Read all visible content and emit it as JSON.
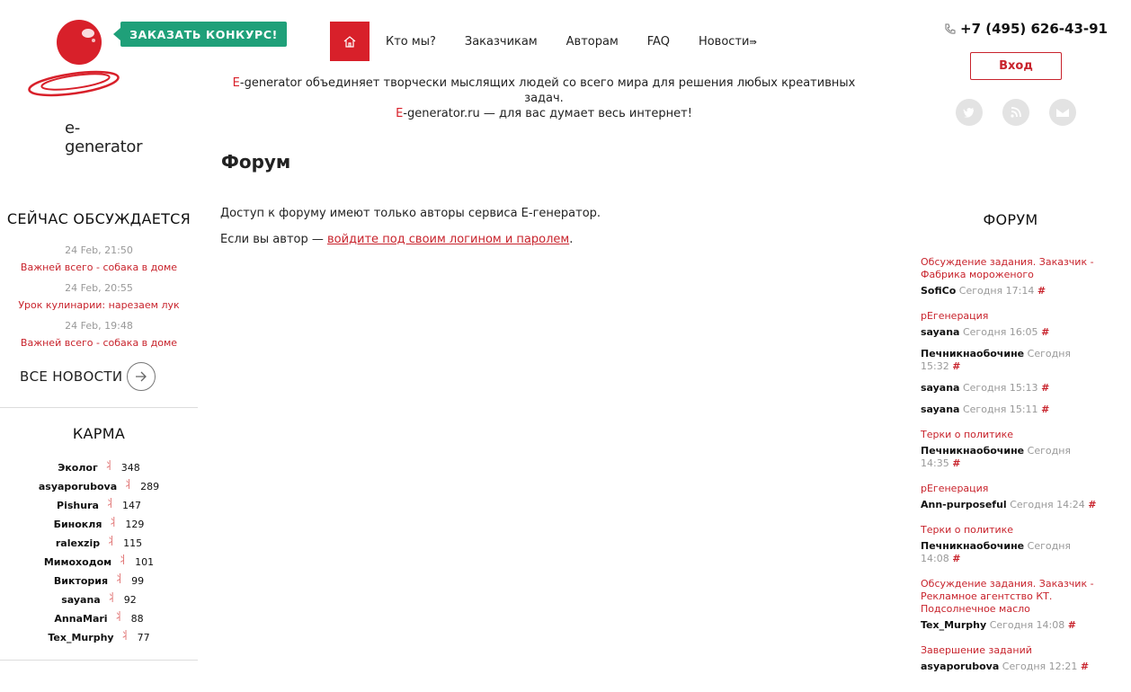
{
  "brand": {
    "name": "e-generator",
    "red": "#d8202a",
    "green": "#1fa079"
  },
  "header": {
    "order_label": "ЗАКАЗАТЬ КОНКУРС!",
    "nav": [
      "Кто мы?",
      "Заказчикам",
      "Авторам",
      "FAQ",
      "Новости"
    ],
    "tagline_1a": "E",
    "tagline_1b": "-generator объединяет творчески мыслящих людей со всего мира для решения любых креативных задач.",
    "tagline_2a": "E",
    "tagline_2b": "-generator.ru — для вас думает весь интернет!",
    "phone": "+7 (495) 626-43-91",
    "login": "Вход",
    "social_icons": [
      "twitter-icon",
      "rss-icon",
      "mail-icon"
    ]
  },
  "main": {
    "title": "Форум",
    "access_text": "Доступ к форуму имеют только авторы сервиса Е-генератор.",
    "author_prefix": "Если вы автор — ",
    "author_link": "войдите под своим логином и паролем",
    "author_suffix": "."
  },
  "left": {
    "discuss_title": "СЕЙЧАС ОБСУЖДАЕТСЯ",
    "discuss": [
      {
        "date": "24 Feb, 21:50",
        "title": "Важней всего - собака в доме"
      },
      {
        "date": "24 Feb, 20:55",
        "title": "Урок кулинарии: нарезаем лук"
      },
      {
        "date": "24 Feb, 19:48",
        "title": "Важней всего - собака в доме"
      }
    ],
    "all_news": "ВСЕ НОВОСТИ",
    "karma_title": "КАРМА",
    "karma": [
      {
        "name": "Эколог",
        "value": "348"
      },
      {
        "name": "asyaporubova",
        "value": "289"
      },
      {
        "name": "Pishura",
        "value": "147"
      },
      {
        "name": "Бинокля",
        "value": "129"
      },
      {
        "name": "ralexzip",
        "value": "115"
      },
      {
        "name": "Мимоходом",
        "value": "101"
      },
      {
        "name": "Виктория",
        "value": "99"
      },
      {
        "name": "sayana",
        "value": "92"
      },
      {
        "name": "AnnaMari",
        "value": "88"
      },
      {
        "name": "Tex_Murphy",
        "value": "77"
      }
    ]
  },
  "right": {
    "forum_title": "ФОРУМ",
    "topics": [
      {
        "title": "Обсуждение задания. Заказчик - Фабрика мороженого",
        "posts": [
          {
            "user": "SofiCo",
            "time": "Сегодня 17:14"
          }
        ]
      },
      {
        "title": "рЕгенерация",
        "posts": [
          {
            "user": "sayana",
            "time": "Сегодня 16:05"
          },
          {
            "user": "Печникнаобочине",
            "time": "Сегодня 15:32"
          },
          {
            "user": "sayana",
            "time": "Сегодня 15:13"
          },
          {
            "user": "sayana",
            "time": "Сегодня 15:11"
          }
        ]
      },
      {
        "title": "Терки о политике",
        "posts": [
          {
            "user": "Печникнаобочине",
            "time": "Сегодня 14:35"
          }
        ]
      },
      {
        "title": "рЕгенерация",
        "posts": [
          {
            "user": "Ann-purposeful",
            "time": "Сегодня 14:24"
          }
        ]
      },
      {
        "title": "Терки о политике",
        "posts": [
          {
            "user": "Печникнаобочине",
            "time": "Сегодня 14:08"
          }
        ]
      },
      {
        "title": "Обсуждение задания. Заказчик - Рекламное агентство КТ. Подсолнечное масло",
        "posts": [
          {
            "user": "Tex_Murphy",
            "time": "Сегодня 14:08"
          }
        ]
      },
      {
        "title": "Завершение заданий",
        "posts": [
          {
            "user": "asyaporubova",
            "time": "Сегодня 12:21"
          }
        ]
      }
    ],
    "hash": "#"
  }
}
